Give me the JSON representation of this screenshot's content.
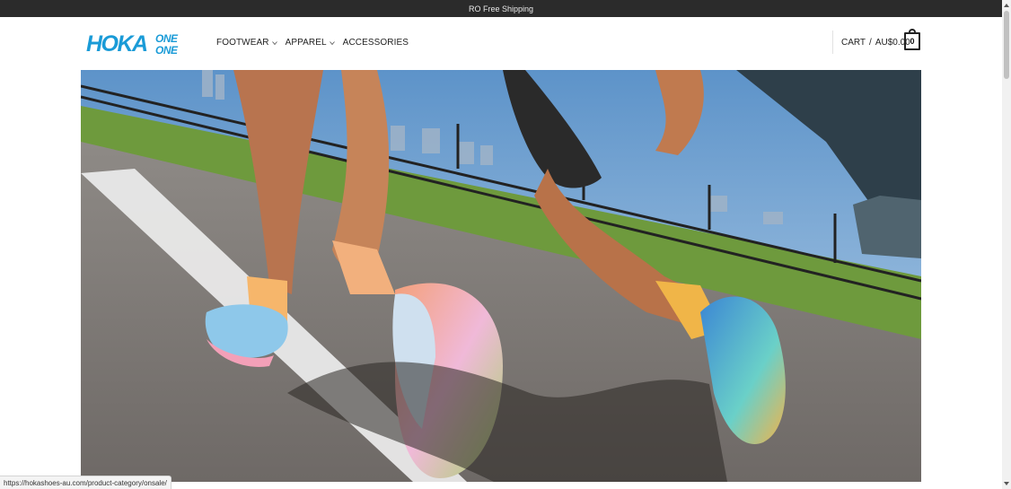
{
  "announcement": {
    "text": "RO Free Shipping"
  },
  "logo": {
    "alt": "HOKA ONE ONE",
    "color": "#1a9bd7"
  },
  "nav": {
    "items": [
      {
        "label": "FOOTWEAR",
        "has_dropdown": true
      },
      {
        "label": "APPAREL",
        "has_dropdown": true
      },
      {
        "label": "ACCESSORIES",
        "has_dropdown": false
      }
    ]
  },
  "cart": {
    "label": "CART",
    "separator": "/",
    "total": "AU$0.00",
    "count": "0"
  },
  "hero": {
    "alt": "Runners wearing HOKA shoes on a riverside path under a bridge"
  },
  "statusbar": {
    "url": "https://hokashoes-au.com/product-category/onsale/"
  },
  "colors": {
    "topbar_bg": "#2b2b2b",
    "brand_blue": "#1a9bd7",
    "text": "#222222"
  }
}
